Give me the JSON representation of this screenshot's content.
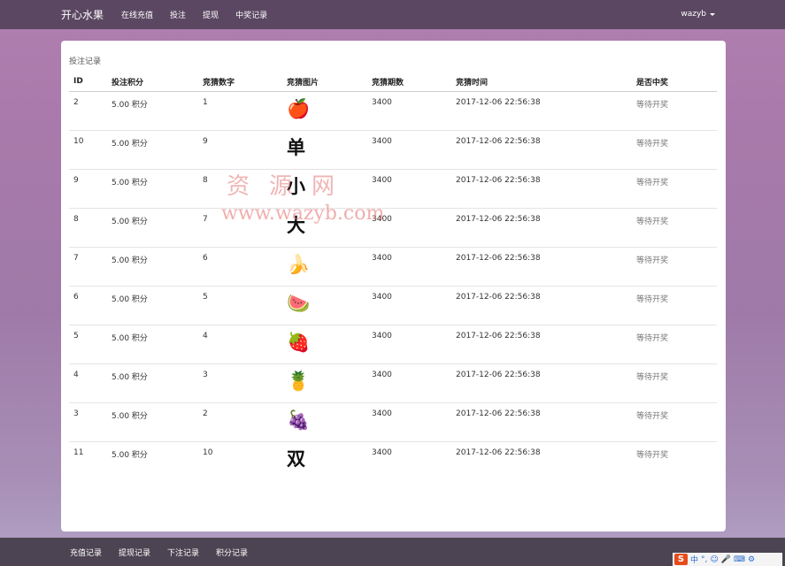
{
  "navbar": {
    "brand": "开心水果",
    "links": [
      "在线充值",
      "投注",
      "提现",
      "中奖记录"
    ],
    "user": "wazyb"
  },
  "panel": {
    "heading": "投注记录",
    "columns": [
      "ID",
      "投注积分",
      "竞猜数字",
      "竞猜图片",
      "竞猜期数",
      "竞猜时间",
      "是否中奖"
    ],
    "rows": [
      {
        "id": "2",
        "points": "5.00 积分",
        "number": "1",
        "pic": "🍎",
        "pic_type": "emoji",
        "period": "3400",
        "time": "2017-12-06 22:56:38",
        "status": "等待开奖"
      },
      {
        "id": "10",
        "points": "5.00 积分",
        "number": "9",
        "pic": "单",
        "pic_type": "text",
        "period": "3400",
        "time": "2017-12-06 22:56:38",
        "status": "等待开奖"
      },
      {
        "id": "9",
        "points": "5.00 积分",
        "number": "8",
        "pic": "小",
        "pic_type": "text",
        "period": "3400",
        "time": "2017-12-06 22:56:38",
        "status": "等待开奖"
      },
      {
        "id": "8",
        "points": "5.00 积分",
        "number": "7",
        "pic": "大",
        "pic_type": "text",
        "period": "3400",
        "time": "2017-12-06 22:56:38",
        "status": "等待开奖"
      },
      {
        "id": "7",
        "points": "5.00 积分",
        "number": "6",
        "pic": "🍌",
        "pic_type": "emoji",
        "period": "3400",
        "time": "2017-12-06 22:56:38",
        "status": "等待开奖"
      },
      {
        "id": "6",
        "points": "5.00 积分",
        "number": "5",
        "pic": "🍉",
        "pic_type": "emoji",
        "period": "3400",
        "time": "2017-12-06 22:56:38",
        "status": "等待开奖"
      },
      {
        "id": "5",
        "points": "5.00 积分",
        "number": "4",
        "pic": "🍓",
        "pic_type": "emoji",
        "period": "3400",
        "time": "2017-12-06 22:56:38",
        "status": "等待开奖"
      },
      {
        "id": "4",
        "points": "5.00 积分",
        "number": "3",
        "pic": "🍍",
        "pic_type": "emoji",
        "period": "3400",
        "time": "2017-12-06 22:56:38",
        "status": "等待开奖"
      },
      {
        "id": "3",
        "points": "5.00 积分",
        "number": "2",
        "pic": "🍇",
        "pic_type": "emoji",
        "period": "3400",
        "time": "2017-12-06 22:56:38",
        "status": "等待开奖"
      },
      {
        "id": "11",
        "points": "5.00 积分",
        "number": "10",
        "pic": "双",
        "pic_type": "text",
        "period": "3400",
        "time": "2017-12-06 22:56:38",
        "status": "等待开奖"
      }
    ]
  },
  "watermark": {
    "text": "资源网",
    "url": "www.wazyb.com"
  },
  "footer": {
    "links": [
      "充值记录",
      "提现记录",
      "下注记录",
      "积分记录"
    ]
  },
  "ime": {
    "logo": "S",
    "items": [
      "中",
      "°,",
      "☺",
      "🎤",
      "⌨",
      "⚙"
    ]
  }
}
